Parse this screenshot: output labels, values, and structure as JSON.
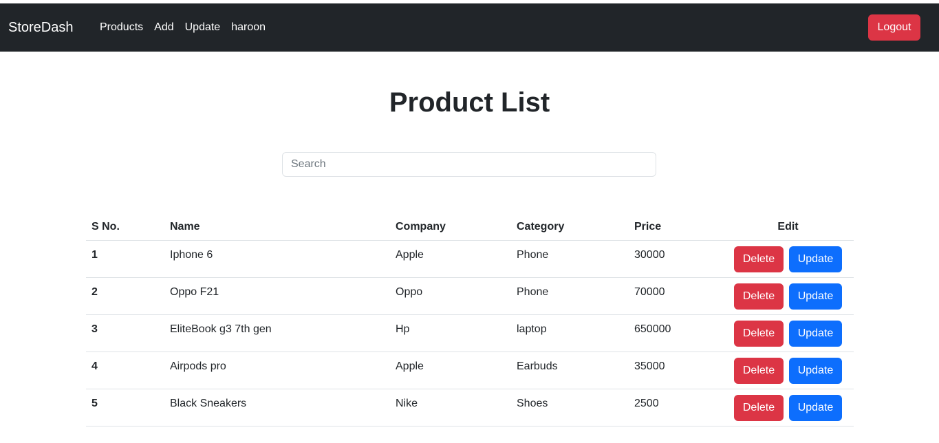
{
  "navbar": {
    "brand": "StoreDash",
    "links": [
      "Products",
      "Add",
      "Update",
      "haroon"
    ],
    "logout_label": "Logout"
  },
  "page": {
    "title": "Product List",
    "search_placeholder": "Search"
  },
  "table": {
    "headers": [
      "S No.",
      "Name",
      "Company",
      "Category",
      "Price",
      "Edit"
    ],
    "rows": [
      {
        "sno": "1",
        "name": "Iphone 6",
        "company": "Apple",
        "category": "Phone",
        "price": "30000"
      },
      {
        "sno": "2",
        "name": "Oppo F21",
        "company": "Oppo",
        "category": "Phone",
        "price": "70000"
      },
      {
        "sno": "3",
        "name": "EliteBook g3 7th gen",
        "company": "Hp",
        "category": "laptop",
        "price": "650000"
      },
      {
        "sno": "4",
        "name": "Airpods pro",
        "company": "Apple",
        "category": "Earbuds",
        "price": "35000"
      },
      {
        "sno": "5",
        "name": "Black Sneakers",
        "company": "Nike",
        "category": "Shoes",
        "price": "2500"
      }
    ],
    "delete_label": "Delete",
    "update_label": "Update"
  },
  "colors": {
    "navbar_bg": "#212529",
    "danger": "#dc3545",
    "primary": "#0d6efd"
  }
}
